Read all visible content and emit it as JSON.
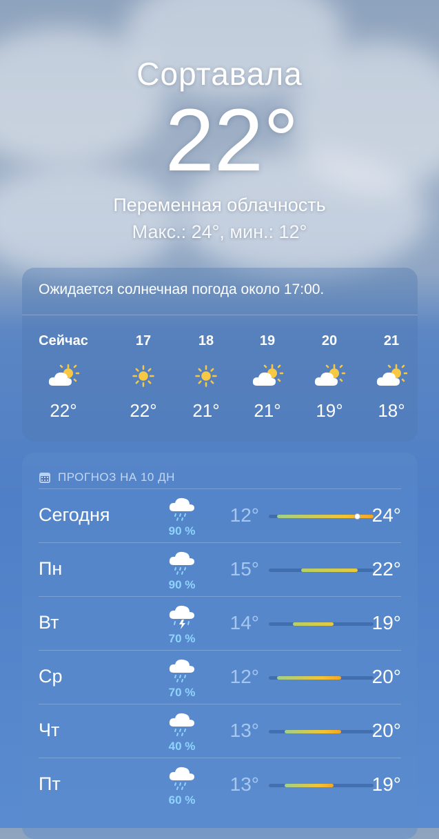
{
  "location": {
    "city": "Сортавала",
    "temperature": "22°",
    "condition": "Переменная облачность",
    "high_low": "Макс.: 24°, мин.: 12°"
  },
  "hourly": {
    "summary": "Ожидается солнечная погода около 17:00.",
    "items": [
      {
        "time": "Сейчас",
        "icon": "partly-cloudy-icon",
        "temp": "22°"
      },
      {
        "time": "17",
        "icon": "sun-icon",
        "temp": "22°"
      },
      {
        "time": "18",
        "icon": "sun-icon",
        "temp": "21°"
      },
      {
        "time": "19",
        "icon": "partly-cloudy-icon",
        "temp": "21°"
      },
      {
        "time": "20",
        "icon": "partly-cloudy-icon",
        "temp": "19°"
      },
      {
        "time": "21",
        "icon": "partly-cloudy-icon",
        "temp": "18°"
      }
    ]
  },
  "forecast": {
    "title": "ПРОГНОЗ НА 10 ДН",
    "days": [
      {
        "day": "Сегодня",
        "icon": "rain-cloud-icon",
        "precip": "90 %",
        "low": "12°",
        "high": "24°",
        "range": [
          12,
          24
        ],
        "current": 22
      },
      {
        "day": "Пн",
        "icon": "rain-cloud-icon",
        "precip": "90 %",
        "low": "15°",
        "high": "22°",
        "range": [
          15,
          22
        ]
      },
      {
        "day": "Вт",
        "icon": "thunderstorm-icon",
        "precip": "70 %",
        "low": "14°",
        "high": "19°",
        "range": [
          14,
          19
        ]
      },
      {
        "day": "Ср",
        "icon": "rain-cloud-icon",
        "precip": "70 %",
        "low": "12°",
        "high": "20°",
        "range": [
          12,
          20
        ]
      },
      {
        "day": "Чт",
        "icon": "rain-cloud-icon",
        "precip": "40 %",
        "low": "13°",
        "high": "20°",
        "range": [
          13,
          20
        ]
      },
      {
        "day": "Пт",
        "icon": "rain-cloud-icon",
        "precip": "60 %",
        "low": "13°",
        "high": "19°",
        "range": [
          13,
          19
        ]
      }
    ],
    "scale": [
      11,
      24
    ]
  }
}
